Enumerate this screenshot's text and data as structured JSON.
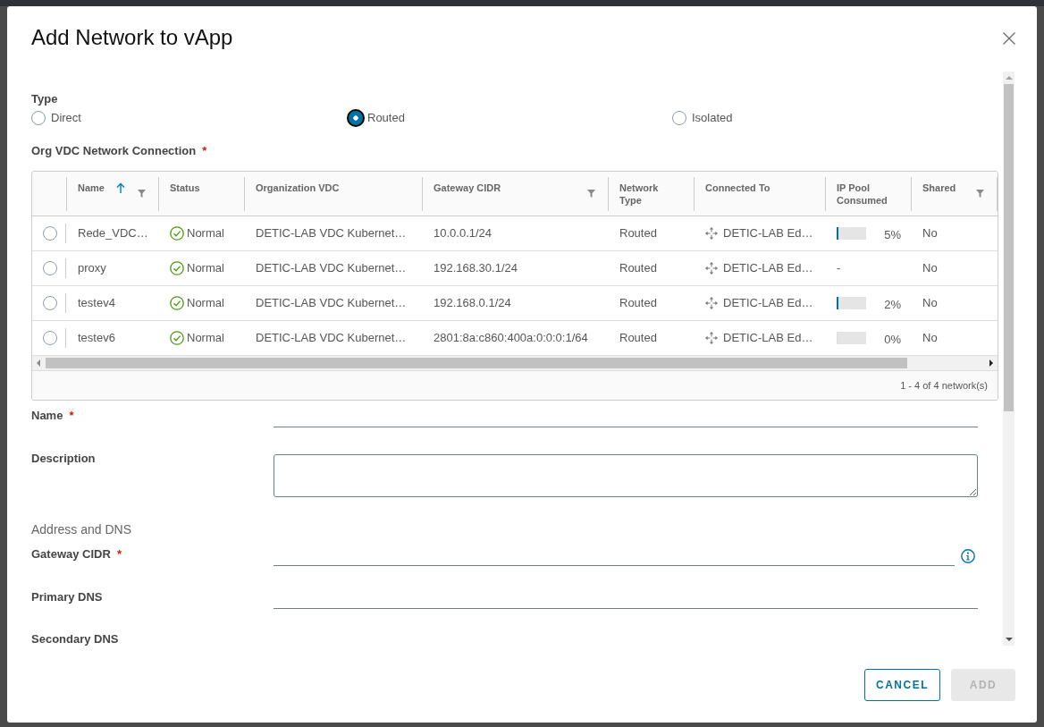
{
  "dialog": {
    "title": "Add Network to vApp"
  },
  "type_field": {
    "label": "Type",
    "options": [
      {
        "label": "Direct",
        "selected": false
      },
      {
        "label": "Routed",
        "selected": true
      },
      {
        "label": "Isolated",
        "selected": false
      }
    ]
  },
  "network_table": {
    "label": "Org VDC Network Connection",
    "required_mark": "*",
    "columns": [
      {
        "label": "Name",
        "kind": "name",
        "sorted": true,
        "filter": true
      },
      {
        "label": "Status",
        "kind": "status",
        "sorted": false,
        "filter": false
      },
      {
        "label": "Organization VDC",
        "kind": "org_vdc",
        "sorted": false,
        "filter": false
      },
      {
        "label": "Gateway CIDR",
        "kind": "gateway_cidr",
        "sorted": false,
        "filter": true
      },
      {
        "label": "Network Type",
        "kind": "network_type",
        "sorted": false,
        "filter": false
      },
      {
        "label": "Connected To",
        "kind": "connected_to",
        "sorted": false,
        "filter": false
      },
      {
        "label": "IP Pool Consumed",
        "kind": "ip_pool",
        "sorted": false,
        "filter": false
      },
      {
        "label": "Shared",
        "kind": "shared",
        "sorted": false,
        "filter": true
      }
    ],
    "rows": [
      {
        "selected": false,
        "name": "Rede_VDC…",
        "status": "Normal",
        "org_vdc": "DETIC-LAB VDC Kubernet…",
        "gateway_cidr": "10.0.0.1/24",
        "network_type": "Routed",
        "connected_to": "DETIC-LAB Ed…",
        "ip_pool": {
          "kind": "meter",
          "level": 0.05,
          "reading": "5%"
        },
        "shared": "No"
      },
      {
        "selected": false,
        "name": "proxy",
        "status": "Normal",
        "org_vdc": "DETIC-LAB VDC Kubernet…",
        "gateway_cidr": "192.168.30.1/24",
        "network_type": "Routed",
        "connected_to": "DETIC-LAB Ed…",
        "ip_pool": {
          "kind": "text",
          "reading": "-"
        },
        "shared": "No"
      },
      {
        "selected": false,
        "name": "testev4",
        "status": "Normal",
        "org_vdc": "DETIC-LAB VDC Kubernet…",
        "gateway_cidr": "192.168.0.1/24",
        "network_type": "Routed",
        "connected_to": "DETIC-LAB Ed…",
        "ip_pool": {
          "kind": "meter",
          "level": 0.02,
          "reading": "2%"
        },
        "shared": "No"
      },
      {
        "selected": false,
        "name": "testev6",
        "status": "Normal",
        "org_vdc": "DETIC-LAB VDC Kubernet…",
        "gateway_cidr": "2801:8a:c860:400a:0:0:0:1/64",
        "network_type": "Routed",
        "connected_to": "DETIC-LAB Ed…",
        "ip_pool": {
          "kind": "meter",
          "level": 0,
          "reading": "0%"
        },
        "shared": "No"
      }
    ],
    "footer": "1 - 4 of 4 network(s)"
  },
  "fields": [
    {
      "kind": "line",
      "label": "Name",
      "required_mark": "*"
    },
    {
      "kind": "textarea",
      "label": "Description"
    },
    {
      "kind": "heading",
      "label": "Address and DNS"
    },
    {
      "kind": "line",
      "label": "Gateway CIDR",
      "required_mark": "*",
      "info": true
    },
    {
      "kind": "line",
      "label": "Primary DNS"
    },
    {
      "kind": "label_only",
      "label": "Secondary DNS"
    }
  ],
  "buttons": [
    {
      "label": "CANCEL",
      "kind": "secondary",
      "disabled": false
    },
    {
      "label": "ADD",
      "kind": "primary",
      "disabled": true
    }
  ]
}
